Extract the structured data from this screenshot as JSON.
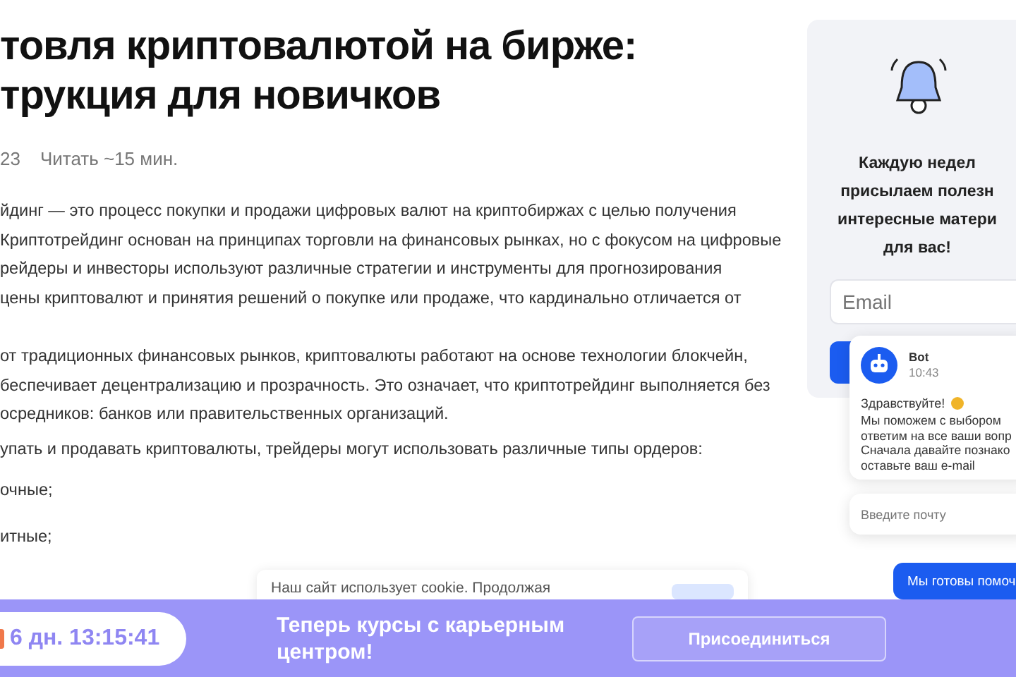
{
  "article": {
    "title_lines": [
      "товля криптовалютой на бирже:",
      "трукция для новичков"
    ],
    "meta": [
      "23",
      "Читать ~15 мин."
    ],
    "paragraphs": [
      [
        "йдинг — это процесс покупки и продажи цифровых валют на криптобиржах с целью получения",
        "Криптотрейдинг основан на принципах торговли на финансовых рынках, но с фокусом на цифровые",
        "рейдеры и инвесторы используют различные стратегии и инструменты для прогнозирования",
        "цены криптовалют и принятия решений о покупке или продаже, что кардинально отличается от"
      ],
      [
        "от традиционных финансовых рынков, криптовалюты работают на основе технологии блокчейн,",
        "беспечивает децентрализацию и прозрачность. Это означает, что криптотрейдинг выполняется без",
        "осредников: банков или правительственных организаций."
      ],
      [
        "упать и продавать криптовалюты, трейдеры могут использовать различные типы ордеров:"
      ]
    ],
    "list_items": [
      "очные;",
      "итные;"
    ]
  },
  "cookie": {
    "text": "Наш сайт использует cookie. Продолжая"
  },
  "subscribe": {
    "lines": [
      "Каждую недел",
      "присылаем полезн",
      "интересные матери",
      "для вас!"
    ],
    "email_placeholder": "Email"
  },
  "chat": {
    "sender": "Bot",
    "time": "10:43",
    "greeting": "Здравствуйте!",
    "lines": [
      "Мы поможем с выбором",
      "ответим на все ваши вопр",
      "Сначала давайте познако",
      "оставьте ваш e-mail"
    ],
    "input_placeholder": "Введите почту",
    "help_button": "Мы готовы помоч"
  },
  "banner": {
    "timer": "6 дн. 13:15:41",
    "headline": "Теперь курсы с карьерным центром!",
    "button": "Присоединиться"
  }
}
